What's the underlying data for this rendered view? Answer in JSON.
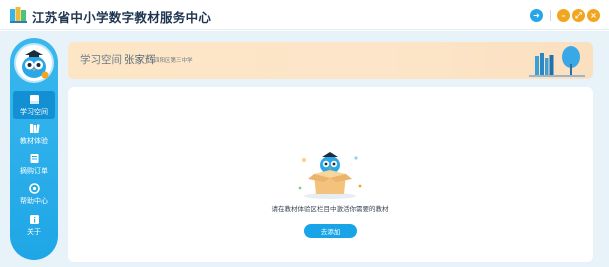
{
  "app": {
    "title": "江苏省中小学数字教材服务中心"
  },
  "window_controls": {
    "icons": [
      "login-arrow-icon",
      "minimize-icon",
      "maximize-icon",
      "close-icon"
    ]
  },
  "sidebar": {
    "items": [
      {
        "label": "学习空间",
        "icon": "learning-space-icon",
        "active": true
      },
      {
        "label": "教材体验",
        "icon": "textbook-experience-icon",
        "active": false
      },
      {
        "label": "摘购订单",
        "icon": "order-icon",
        "active": false
      },
      {
        "label": "帮助中心",
        "icon": "help-icon",
        "active": false
      },
      {
        "label": "关于",
        "icon": "about-icon",
        "active": false
      }
    ]
  },
  "banner": {
    "title": "学习空间",
    "user_name": "张家辉",
    "school": "四阳区第三中学"
  },
  "empty_state": {
    "message": "请在教材体验区栏目中激活你需要的教材",
    "button_label": "去添加"
  },
  "colors": {
    "accent": "#1aa4e8",
    "sidebar": "#29afec",
    "banner": "#fde5c6",
    "background": "#e8f2f9"
  }
}
